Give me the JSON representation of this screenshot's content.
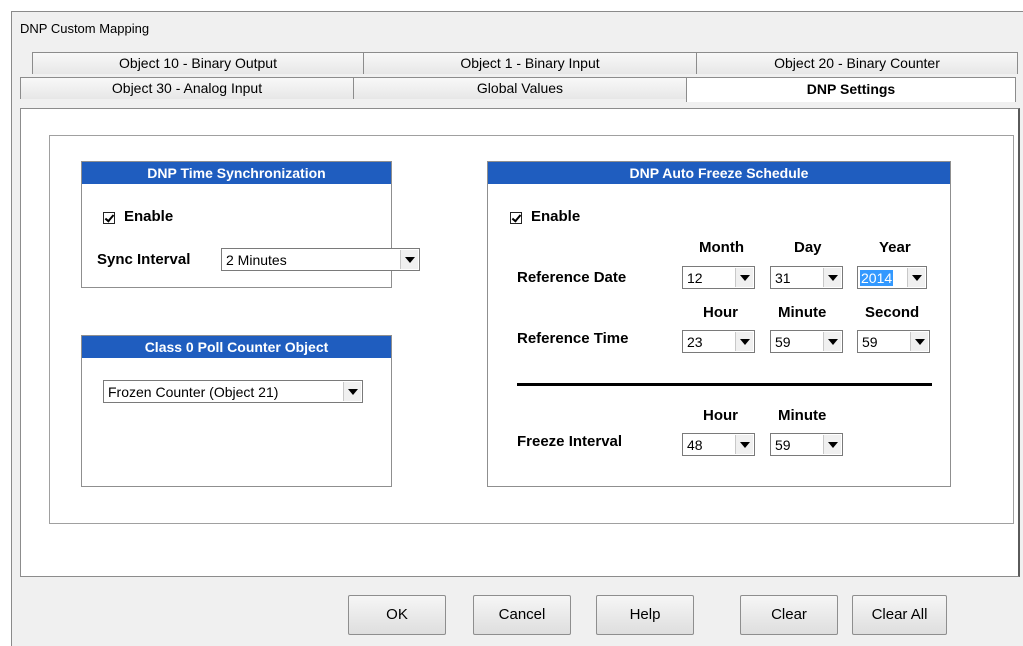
{
  "window": {
    "title": "DNP Custom Mapping"
  },
  "tabs": {
    "row1": [
      "Object 10 - Binary Output",
      "Object 1 - Binary Input",
      "Object 20 - Binary Counter"
    ],
    "row2": [
      "Object 30 - Analog Input",
      "Global Values",
      "DNP Settings"
    ],
    "active": "DNP Settings"
  },
  "time_sync": {
    "title": "DNP Time Synchronization",
    "enable_label": "Enable",
    "enabled": true,
    "sync_interval_label": "Sync Interval",
    "sync_interval_value": "2 Minutes"
  },
  "class0": {
    "title": "Class 0 Poll Counter Object",
    "value": "Frozen Counter (Object 21)"
  },
  "auto_freeze": {
    "title": "DNP Auto Freeze Schedule",
    "enable_label": "Enable",
    "enabled": true,
    "date_headers": {
      "month": "Month",
      "day": "Day",
      "year": "Year"
    },
    "reference_date_label": "Reference Date",
    "reference_date": {
      "month": "12",
      "day": "31",
      "year": "2014"
    },
    "time_headers": {
      "hour": "Hour",
      "minute": "Minute",
      "second": "Second"
    },
    "reference_time_label": "Reference Time",
    "reference_time": {
      "hour": "23",
      "minute": "59",
      "second": "59"
    },
    "interval_headers": {
      "hour": "Hour",
      "minute": "Minute"
    },
    "freeze_interval_label": "Freeze Interval",
    "freeze_interval": {
      "hour": "48",
      "minute": "59"
    }
  },
  "buttons": {
    "ok": "OK",
    "cancel": "Cancel",
    "help": "Help",
    "clear": "Clear",
    "clear_all": "Clear All"
  }
}
